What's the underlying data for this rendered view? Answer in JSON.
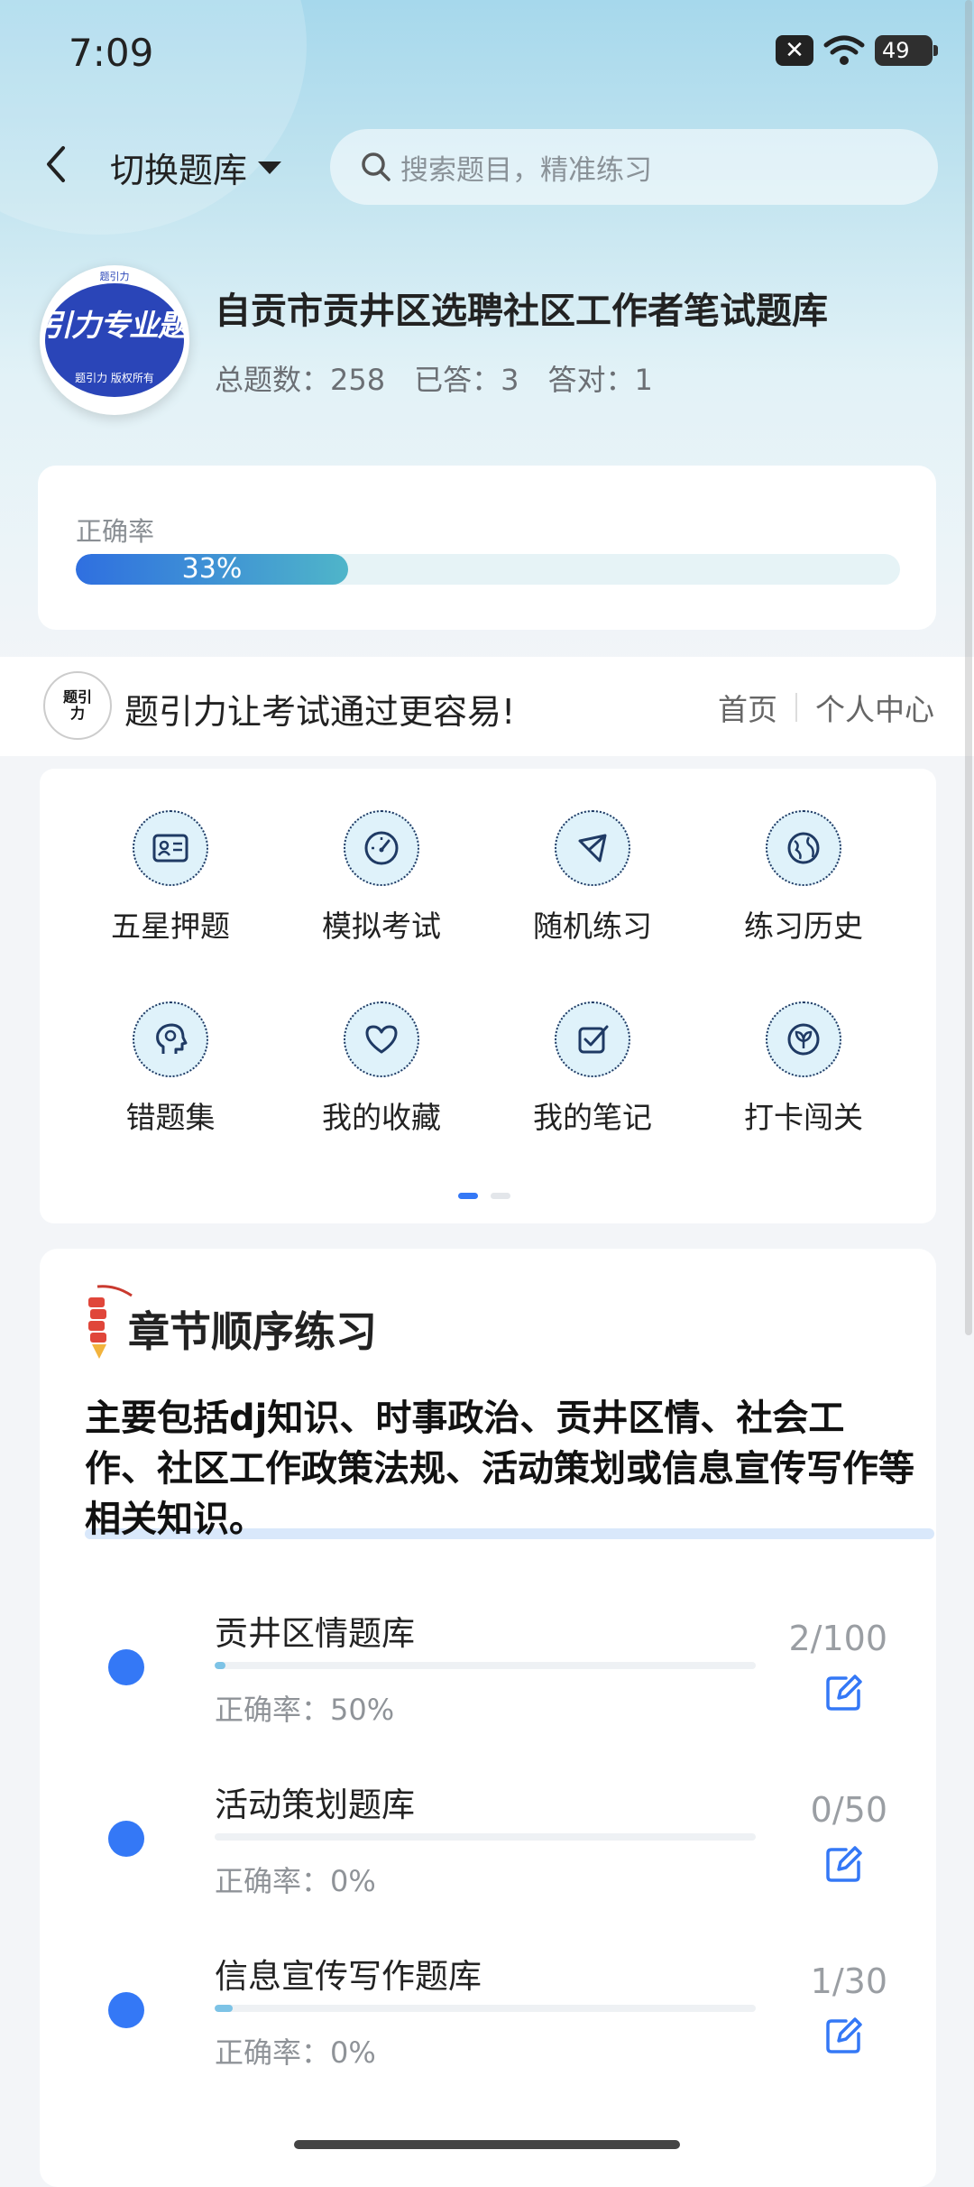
{
  "status_bar": {
    "time": "7:09",
    "battery": "49"
  },
  "top_nav": {
    "switch_label": "切换题库",
    "search_placeholder": "搜索题目，精准练习"
  },
  "bank": {
    "logo_text": "引力专业题",
    "logo_sub": "题引力 版权所有",
    "logo_top": "题引力",
    "title": "自贡市贡井区选聘社区工作者笔试题库",
    "total_label": "总题数：258",
    "answered_label": "已答：3",
    "correct_label": "答对：1"
  },
  "accuracy": {
    "label": "正确率",
    "value_text": "33%",
    "value": 0.33
  },
  "promo": {
    "logo_text": "题引力",
    "slogan": "题引力让考试通过更容易!",
    "home_link": "首页",
    "profile_link": "个人中心"
  },
  "menu": {
    "items": [
      {
        "label": "五星押题",
        "icon": "id-card-icon"
      },
      {
        "label": "模拟考试",
        "icon": "gauge-icon"
      },
      {
        "label": "随机练习",
        "icon": "network-icon"
      },
      {
        "label": "练习历史",
        "icon": "globe-icon"
      },
      {
        "label": "错题集",
        "icon": "head-icon"
      },
      {
        "label": "我的收藏",
        "icon": "heart-icon"
      },
      {
        "label": "我的笔记",
        "icon": "check-note-icon"
      },
      {
        "label": "打卡闯关",
        "icon": "leaf-icon"
      }
    ],
    "active_page": 1,
    "page_count": 2
  },
  "chapter": {
    "title": "章节顺序练习",
    "description": "主要包括dj知识、时事政治、贡井区情、社会工作、社区工作政策法规、活动策划或信息宣传写作等相关知识。",
    "rows": [
      {
        "name": "贡井区情题库",
        "accuracy": "正确率：50%",
        "count": "2/100",
        "progress": 0.02
      },
      {
        "name": "活动策划题库",
        "accuracy": "正确率：0%",
        "count": "0/50",
        "progress": 0.0
      },
      {
        "name": "信息宣传写作题库",
        "accuracy": "正确率：0%",
        "count": "1/30",
        "progress": 0.033
      }
    ]
  },
  "colors": {
    "accent": "#3478f6",
    "icon_bg": "#dff2fa",
    "icon_stroke": "#1f3a64"
  }
}
